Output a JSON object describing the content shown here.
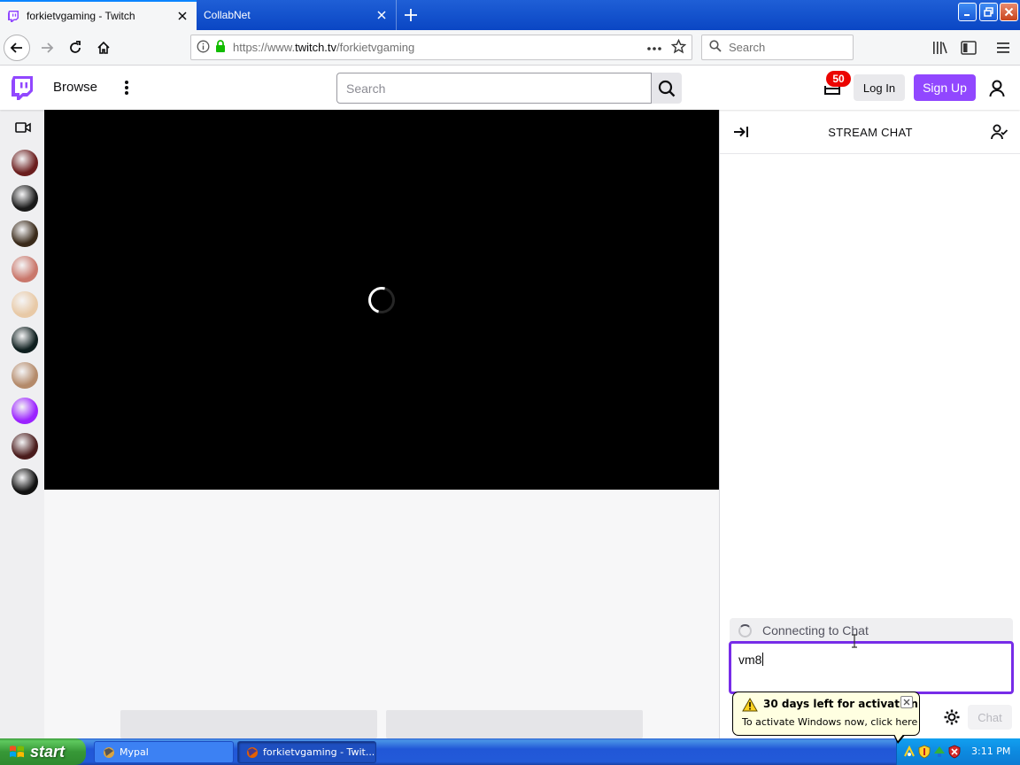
{
  "browser": {
    "tabs": [
      {
        "title": "forkietvgaming - Twitch",
        "active": true
      },
      {
        "title": "CollabNet",
        "active": false
      }
    ],
    "url_prefix": "https://www.",
    "url_domain": "twitch.tv",
    "url_path": "/forkietvgaming",
    "search_placeholder": "Search"
  },
  "twitch": {
    "browse_label": "Browse",
    "search_placeholder": "Search",
    "notification_count": "50",
    "login_label": "Log In",
    "signup_label": "Sign Up",
    "accent_color": "#9147ff"
  },
  "sidebar": {
    "channels": [
      {
        "name": "channel-1",
        "color": "#6b1e1e"
      },
      {
        "name": "channel-2",
        "color": "#1a1a1a"
      },
      {
        "name": "channel-3",
        "color": "#3a2a1a"
      },
      {
        "name": "channel-4",
        "color": "#c9776b"
      },
      {
        "name": "channel-5",
        "color": "#e8c9a6"
      },
      {
        "name": "channel-6",
        "color": "#0f1f1f"
      },
      {
        "name": "channel-7",
        "color": "#b48a6a"
      },
      {
        "name": "channel-8",
        "color": "#9b22ff"
      },
      {
        "name": "channel-9",
        "color": "#4a1c1c"
      },
      {
        "name": "channel-10",
        "color": "#111111"
      }
    ]
  },
  "chat": {
    "title": "STREAM CHAT",
    "connecting_text": "Connecting to Chat",
    "input_value": "vm8",
    "send_label": "Chat"
  },
  "balloon": {
    "title": "30 days left for activation",
    "text": "To activate Windows now, click here"
  },
  "taskbar": {
    "start_label": "start",
    "tasks": [
      {
        "label": "Mypal"
      },
      {
        "label": "forkietvgaming - Twit..."
      }
    ],
    "clock": "3:11 PM"
  }
}
